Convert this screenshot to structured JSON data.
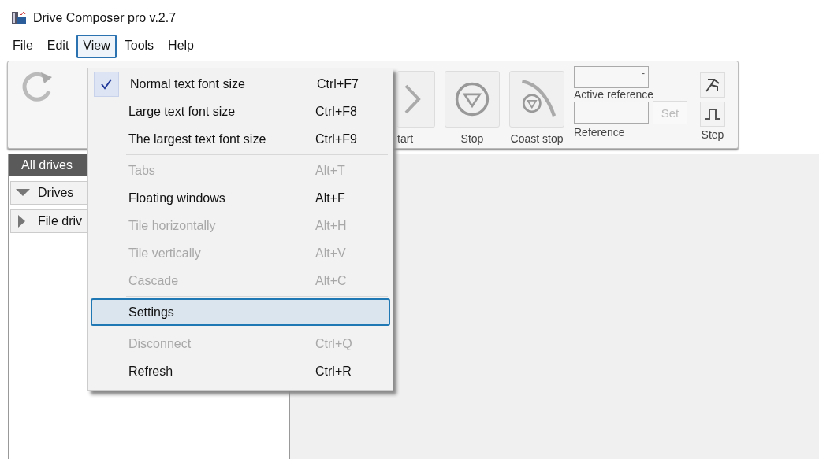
{
  "window": {
    "title": "Drive Composer pro v.2.7"
  },
  "menubar": [
    {
      "label": "File",
      "selected": false
    },
    {
      "label": "Edit",
      "selected": false
    },
    {
      "label": "View",
      "selected": true
    },
    {
      "label": "Tools",
      "selected": false
    },
    {
      "label": "Help",
      "selected": false
    }
  ],
  "toolbar": {
    "buttons": [
      {
        "kind": "start",
        "label": "tart"
      },
      {
        "kind": "stop",
        "label": "Stop"
      },
      {
        "kind": "coast",
        "label": "Coast stop"
      }
    ],
    "active_reference": {
      "value": "-",
      "label": "Active reference"
    },
    "reference": {
      "label": "Reference",
      "set_button": "Set",
      "set_disabled": true
    },
    "step": {
      "label": "Step"
    }
  },
  "sidebar": {
    "tab": "All drives",
    "items": [
      {
        "label": "Drives",
        "expanded": true
      },
      {
        "label": "File driv",
        "expanded": false
      }
    ]
  },
  "view_menu": [
    {
      "kind": "item",
      "label": "Normal text font size",
      "shortcut": "Ctrl+F7",
      "checked": true,
      "disabled": false,
      "selected": false
    },
    {
      "kind": "item",
      "label": "Large text font size",
      "shortcut": "Ctrl+F8",
      "checked": false,
      "disabled": false,
      "selected": false
    },
    {
      "kind": "item",
      "label": "The largest text font size",
      "shortcut": "Ctrl+F9",
      "checked": false,
      "disabled": false,
      "selected": false
    },
    {
      "kind": "separator"
    },
    {
      "kind": "item",
      "label": "Tabs",
      "shortcut": "Alt+T",
      "checked": false,
      "disabled": true,
      "selected": false
    },
    {
      "kind": "item",
      "label": "Floating windows",
      "shortcut": "Alt+F",
      "checked": false,
      "disabled": false,
      "selected": false
    },
    {
      "kind": "item",
      "label": "Tile horizontally",
      "shortcut": "Alt+H",
      "checked": false,
      "disabled": true,
      "selected": false
    },
    {
      "kind": "item",
      "label": "Tile vertically",
      "shortcut": "Alt+V",
      "checked": false,
      "disabled": true,
      "selected": false
    },
    {
      "kind": "item",
      "label": "Cascade",
      "shortcut": "Alt+C",
      "checked": false,
      "disabled": true,
      "selected": false
    },
    {
      "kind": "separator"
    },
    {
      "kind": "item",
      "label": "Settings",
      "checked": false,
      "disabled": false,
      "selected": true
    },
    {
      "kind": "separator"
    },
    {
      "kind": "item",
      "label": "Disconnect",
      "shortcut": "Ctrl+Q",
      "checked": false,
      "disabled": true,
      "selected": false
    },
    {
      "kind": "item",
      "label": "Refresh",
      "shortcut": "Ctrl+R",
      "checked": false,
      "disabled": false,
      "selected": false
    }
  ]
}
